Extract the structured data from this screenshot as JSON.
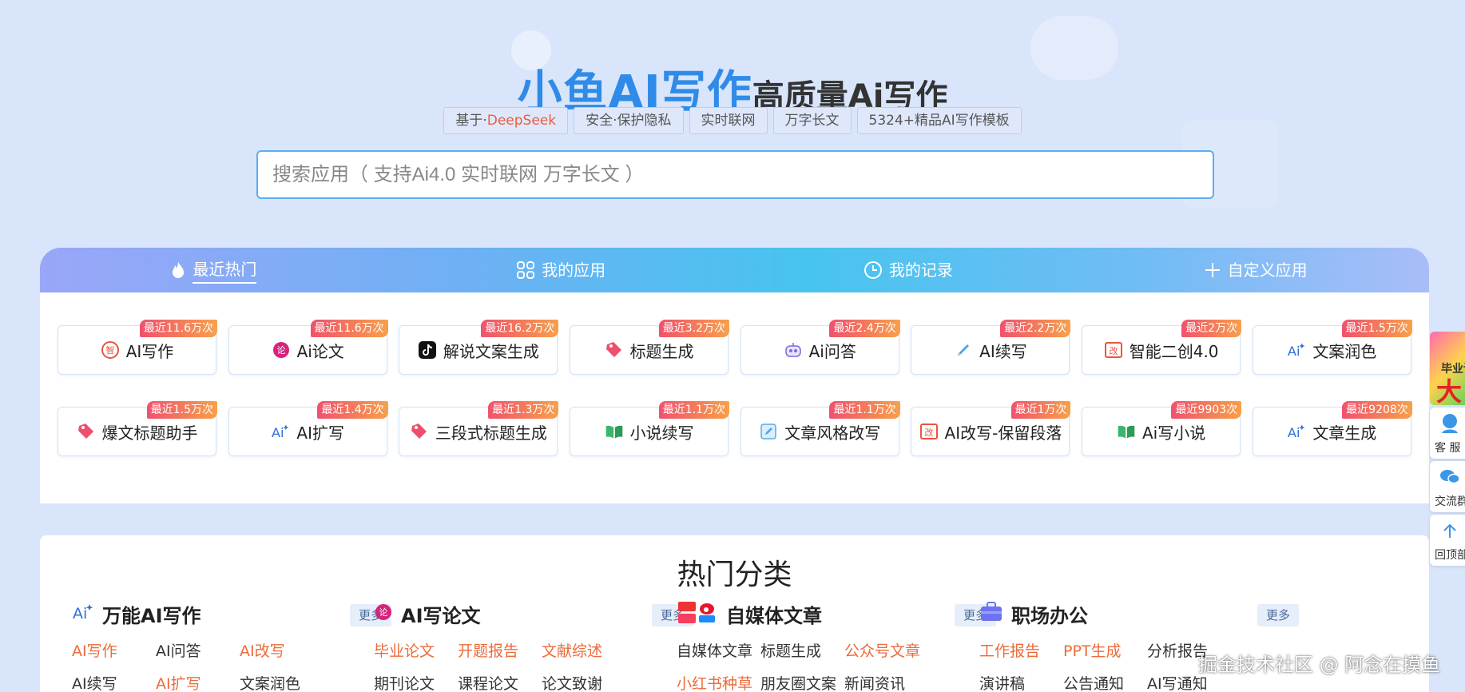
{
  "hero": {
    "brand": "小鱼AI写作",
    "subtitle": "高质量Ai写作",
    "tags": [
      {
        "prefix": "基于·",
        "highlight": "DeepSeek"
      },
      {
        "prefix": "安全·保护隐私",
        "highlight": ""
      },
      {
        "prefix": "实时联网",
        "highlight": ""
      },
      {
        "prefix": "万字长文",
        "highlight": ""
      },
      {
        "prefix": "5324+精品AI写作模板",
        "highlight": ""
      }
    ],
    "search_placeholder": "搜索应用（ 支持Ai4.0 实时联网 万字长文 ）"
  },
  "tabs": [
    {
      "label": "最近热门",
      "icon": "flame-icon",
      "active": true
    },
    {
      "label": "我的应用",
      "icon": "apps-grid-icon",
      "active": false
    },
    {
      "label": "我的记录",
      "icon": "clock-icon",
      "active": false
    },
    {
      "label": "自定义应用",
      "icon": "plus-icon",
      "active": false
    }
  ],
  "apps": [
    {
      "name": "AI写作",
      "badge": "最近11.6万次",
      "icon": "zhi-badge-icon"
    },
    {
      "name": "Ai论文",
      "badge": "最近11.6万次",
      "icon": "lun-badge-icon"
    },
    {
      "name": "解说文案生成",
      "badge": "最近16.2万次",
      "icon": "tiktok-icon"
    },
    {
      "name": "标题生成",
      "badge": "最近3.2万次",
      "icon": "tag-icon"
    },
    {
      "name": "Ai问答",
      "badge": "最近2.4万次",
      "icon": "robot-icon"
    },
    {
      "name": "AI续写",
      "badge": "最近2.2万次",
      "icon": "pencil-icon"
    },
    {
      "name": "智能二创4.0",
      "badge": "最近2万次",
      "icon": "rewrite-icon"
    },
    {
      "name": "文案润色",
      "badge": "最近1.5万次",
      "icon": "ai-sparkle-icon"
    },
    {
      "name": "爆文标题助手",
      "badge": "最近1.5万次",
      "icon": "tag-icon"
    },
    {
      "name": "AI扩写",
      "badge": "最近1.4万次",
      "icon": "ai-sparkle-icon"
    },
    {
      "name": "三段式标题生成",
      "badge": "最近1.3万次",
      "icon": "tag-icon"
    },
    {
      "name": "小说续写",
      "badge": "最近1.1万次",
      "icon": "book-icon"
    },
    {
      "name": "文章风格改写",
      "badge": "最近1.1万次",
      "icon": "edit-icon"
    },
    {
      "name": "AI改写-保留段落",
      "badge": "最近1万次",
      "icon": "rewrite-icon"
    },
    {
      "name": "Ai写小说",
      "badge": "最近9903次",
      "icon": "book-icon"
    },
    {
      "name": "文章生成",
      "badge": "最近9208次",
      "icon": "ai-sparkle-icon"
    }
  ],
  "categories": {
    "title": "热门分类",
    "more_label": "更多",
    "columns": [
      {
        "title": "万能AI写作",
        "icon": "ai-sparkle-icon",
        "links": [
          {
            "label": "AI写作",
            "style": "orange"
          },
          {
            "label": "AI问答",
            "style": "dark"
          },
          {
            "label": "AI改写",
            "style": "orange"
          },
          {
            "label": "AI续写",
            "style": "dark"
          },
          {
            "label": "AI扩写",
            "style": "orange"
          },
          {
            "label": "文案润色",
            "style": "dark"
          }
        ]
      },
      {
        "title": "AI写论文",
        "icon": "lun-badge-icon",
        "links": [
          {
            "label": "毕业论文",
            "style": "orange"
          },
          {
            "label": "开题报告",
            "style": "orange"
          },
          {
            "label": "文献综述",
            "style": "orange"
          },
          {
            "label": "期刊论文",
            "style": "dark"
          },
          {
            "label": "课程论文",
            "style": "dark"
          },
          {
            "label": "论文致谢",
            "style": "dark"
          }
        ]
      },
      {
        "title": "自媒体文章",
        "icon": "media-logos-icon",
        "links": [
          {
            "label": "自媒体文章",
            "style": "dark"
          },
          {
            "label": "标题生成",
            "style": "dark"
          },
          {
            "label": "公众号文章",
            "style": "orange"
          },
          {
            "label": "小红书种草",
            "style": "orange"
          },
          {
            "label": "朋友圈文案",
            "style": "dark"
          },
          {
            "label": "新闻资讯",
            "style": "dark"
          }
        ]
      },
      {
        "title": "职场办公",
        "icon": "briefcase-icon",
        "links": [
          {
            "label": "工作报告",
            "style": "orange"
          },
          {
            "label": "PPT生成",
            "style": "orange"
          },
          {
            "label": "分析报告",
            "style": "dark"
          },
          {
            "label": "演讲稿",
            "style": "dark"
          },
          {
            "label": "公告通知",
            "style": "dark"
          },
          {
            "label": "AI写通知",
            "style": "dark"
          }
        ]
      }
    ]
  },
  "sidebar": {
    "promo_line1": "毕业论",
    "promo_line2": "大",
    "service": "客 服",
    "group": "交流群",
    "top": "回顶部"
  },
  "watermark": "掘金技术社区 @ 阿念在摸鱼",
  "colors": {
    "brand_blue": "#2f8be7",
    "badge_start": "#f0526e",
    "badge_end": "#f7a04a",
    "link_orange": "#ec6b3a"
  }
}
